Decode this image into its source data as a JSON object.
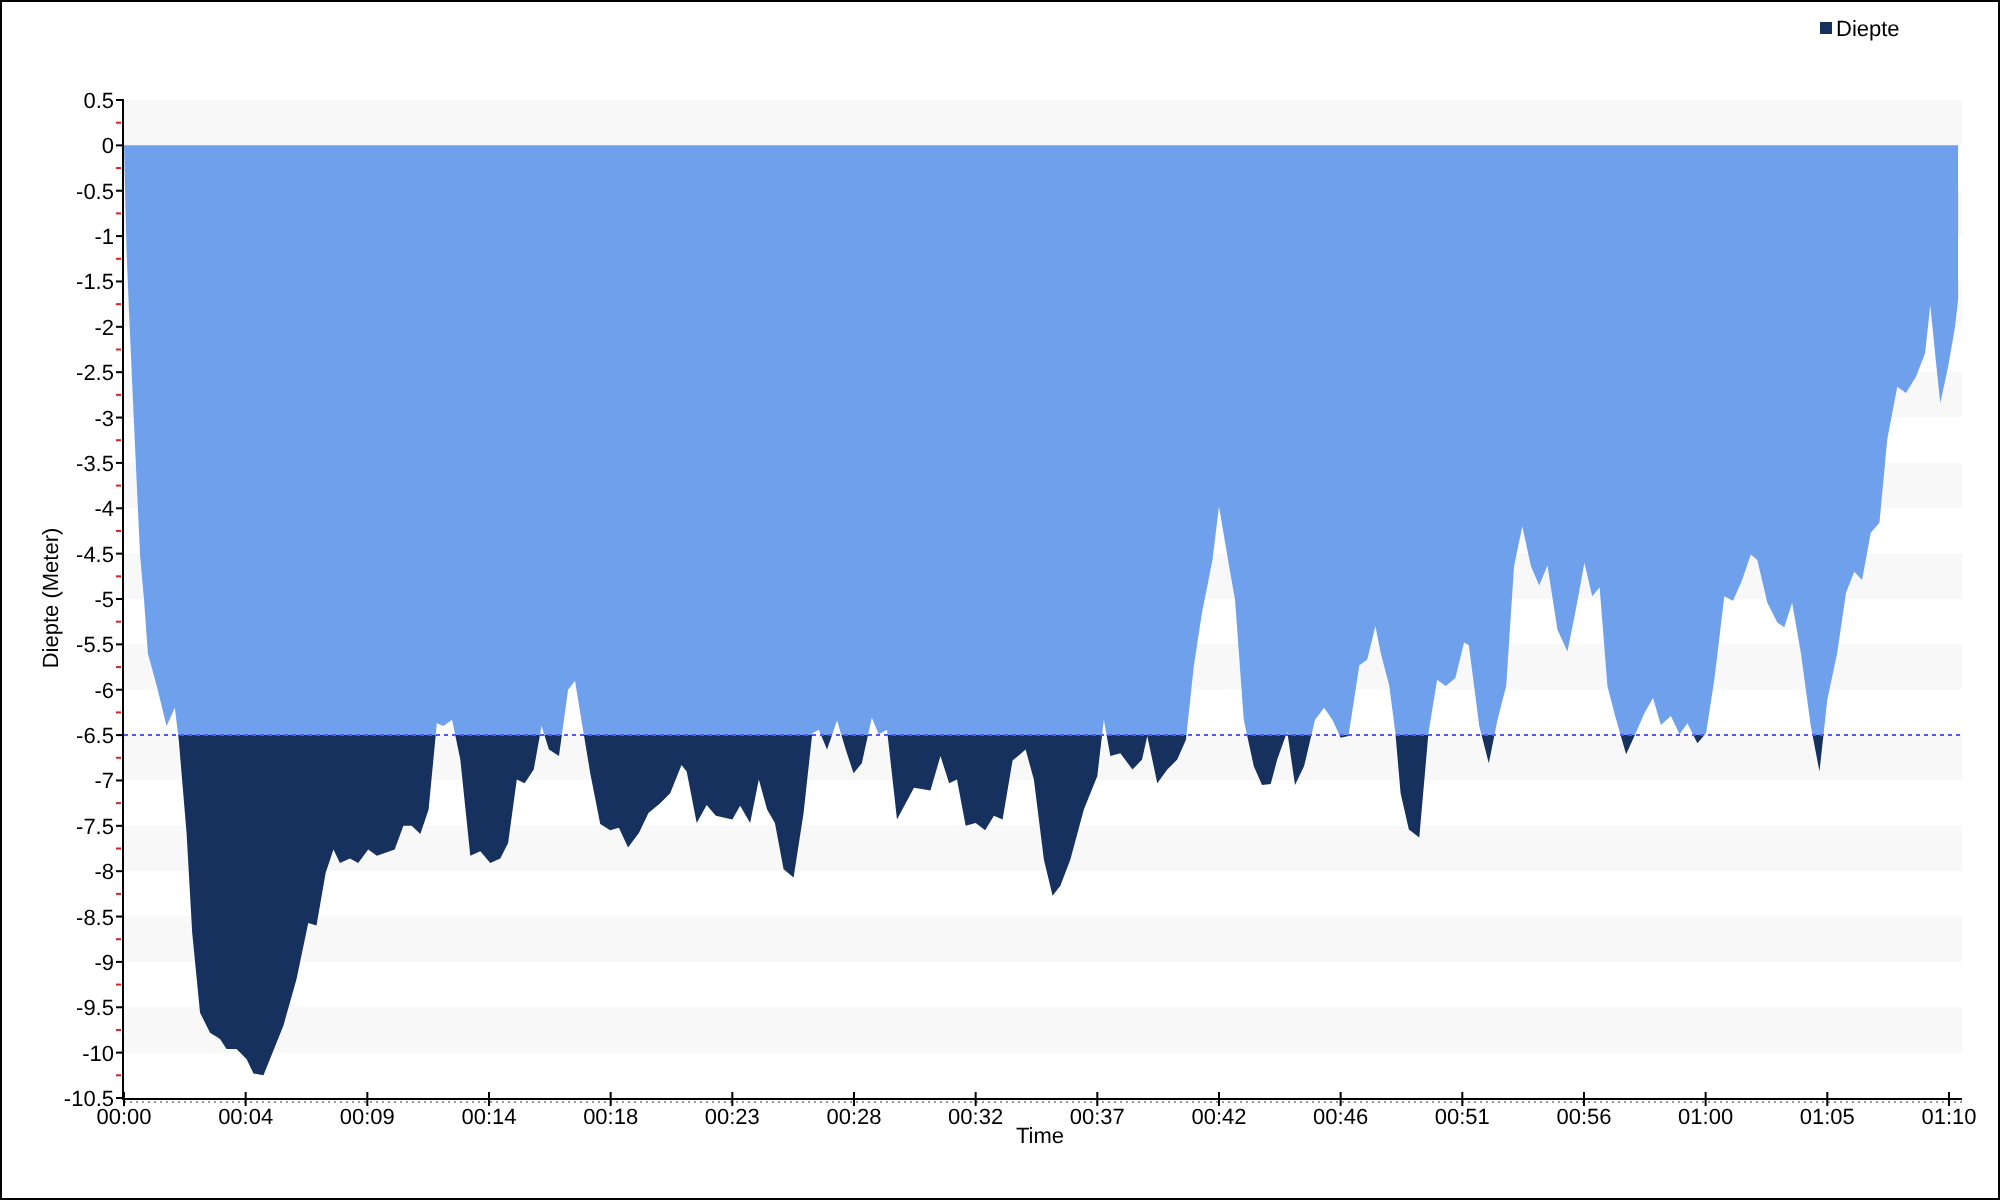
{
  "chart": {
    "chart_data": {
      "type": "area",
      "xlabel": "Time",
      "ylabel": "Diepte (Meter)",
      "x": [
        -20,
        -14,
        -9,
        -3,
        2,
        9,
        17,
        26,
        35,
        55,
        78,
        97,
        106,
        124,
        137,
        155,
        178,
        201,
        216,
        239,
        262,
        278,
        301,
        347,
        377,
        404,
        423,
        444,
        462,
        477,
        500,
        519,
        542,
        562,
        603,
        623,
        642,
        662,
        681,
        700,
        715,
        735,
        754,
        777,
        800,
        823,
        846,
        864,
        884,
        902,
        923,
        941,
        958,
        981,
        1002,
        1018,
        1035,
        1053,
        1076,
        1099,
        1119,
        1140,
        1165,
        1187,
        1214,
        1237,
        1263,
        1275,
        1298,
        1321,
        1342,
        1380,
        1398,
        1421,
        1441,
        1460,
        1478,
        1498,
        1521,
        1544,
        1564,
        1579,
        1598,
        1621,
        1641,
        1659,
        1678,
        1701,
        1717,
        1736,
        1759,
        1798,
        1836,
        1859,
        1879,
        1897,
        1917,
        1940,
        1962,
        1982,
        2002,
        2025,
        2055,
        2074,
        2097,
        2117,
        2135,
        2158,
        2189,
        2220,
        2235,
        2250,
        2273,
        2301,
        2323,
        2335,
        2358,
        2381,
        2404,
        2424,
        2442,
        2461,
        2485,
        2500,
        2522,
        2537,
        2557,
        2580,
        2599,
        2619,
        2634,
        2657,
        2675,
        2696,
        2721,
        2742,
        2761,
        2780,
        2798,
        2823,
        2841,
        2860,
        2872,
        2892,
        2906,
        2918,
        2937,
        2961,
        2982,
        3002,
        3022,
        3044,
        3064,
        3075,
        3099,
        3121,
        3141,
        3161,
        3179,
        3198,
        3218,
        3237,
        3256,
        3279,
        3302,
        3320,
        3341,
        3359,
        3376,
        3394,
        3410,
        3437,
        3459,
        3479,
        3499,
        3517,
        3540,
        3560,
        3578,
        3601,
        3621,
        3640,
        3663,
        3683,
        3704,
        3724,
        3739,
        3762,
        3785,
        3801,
        3819,
        3839,
        3862,
        3882,
        3900,
        3923,
        3943,
        3962,
        3980,
        4000,
        4020,
        4038,
        4061,
        4081,
        4104,
        4125,
        4137,
        4148,
        4160,
        4178,
        4194,
        4201
      ],
      "series": [
        {
          "name": "Diepte",
          "color": "#17315f",
          "values": [
            0,
            -1.19,
            -1.77,
            -2.43,
            -2.96,
            -3.69,
            -4.52,
            -5.0,
            -5.6,
            -5.95,
            -6.4,
            -6.2,
            -6.55,
            -7.58,
            -8.68,
            -9.56,
            -9.78,
            -9.85,
            -9.96,
            -9.96,
            -10.07,
            -10.23,
            -10.25,
            -9.7,
            -9.19,
            -8.57,
            -8.6,
            -8.02,
            -7.76,
            -7.91,
            -7.86,
            -7.91,
            -7.76,
            -7.83,
            -7.76,
            -7.5,
            -7.5,
            -7.59,
            -7.32,
            -6.37,
            -6.4,
            -6.33,
            -6.77,
            -7.83,
            -7.78,
            -7.91,
            -7.86,
            -7.69,
            -6.99,
            -7.03,
            -6.88,
            -6.4,
            -6.66,
            -6.73,
            -6.0,
            -5.9,
            -6.4,
            -6.92,
            -7.48,
            -7.55,
            -7.52,
            -7.74,
            -7.58,
            -7.36,
            -7.25,
            -7.14,
            -6.83,
            -6.9,
            -7.47,
            -7.27,
            -7.39,
            -7.43,
            -7.28,
            -7.47,
            -6.99,
            -7.32,
            -7.47,
            -7.98,
            -8.07,
            -7.36,
            -6.48,
            -6.44,
            -6.66,
            -6.34,
            -6.66,
            -6.92,
            -6.81,
            -6.31,
            -6.49,
            -6.44,
            -7.43,
            -7.08,
            -7.11,
            -6.73,
            -7.03,
            -6.99,
            -7.5,
            -7.47,
            -7.55,
            -7.39,
            -7.43,
            -6.78,
            -6.66,
            -6.99,
            -7.87,
            -8.27,
            -8.16,
            -7.87,
            -7.32,
            -6.95,
            -6.33,
            -6.73,
            -6.7,
            -6.88,
            -6.77,
            -6.51,
            -7.03,
            -6.88,
            -6.77,
            -6.55,
            -5.74,
            -5.15,
            -4.57,
            -3.98,
            -4.6,
            -5.01,
            -6.33,
            -6.84,
            -7.05,
            -7.04,
            -6.77,
            -6.46,
            -7.05,
            -6.84,
            -6.33,
            -6.2,
            -6.33,
            -6.53,
            -6.51,
            -5.73,
            -5.67,
            -5.3,
            -5.59,
            -5.96,
            -6.48,
            -7.14,
            -7.54,
            -7.63,
            -6.48,
            -5.89,
            -5.96,
            -5.87,
            -5.48,
            -5.51,
            -6.4,
            -6.81,
            -6.33,
            -5.96,
            -4.64,
            -4.2,
            -4.64,
            -4.85,
            -4.63,
            -5.34,
            -5.58,
            -5.15,
            -4.6,
            -4.97,
            -4.87,
            -5.96,
            -6.26,
            -6.71,
            -6.48,
            -6.26,
            -6.09,
            -6.39,
            -6.29,
            -6.49,
            -6.37,
            -6.59,
            -6.48,
            -5.89,
            -4.97,
            -5.02,
            -4.79,
            -4.51,
            -4.57,
            -5.04,
            -5.26,
            -5.31,
            -5.04,
            -5.59,
            -6.4,
            -6.9,
            -6.11,
            -5.59,
            -4.93,
            -4.7,
            -4.79,
            -4.27,
            -4.16,
            -3.24,
            -2.66,
            -2.73,
            -2.55,
            -2.29,
            -1.76,
            -2.29,
            -2.84,
            -2.44,
            -2.0,
            -1.7
          ]
        }
      ],
      "xlim": [
        -20,
        4210
      ],
      "ylim": [
        -10.5,
        0.5
      ],
      "xticks": [
        {
          "value": -20,
          "label": "00:00"
        },
        {
          "value": 260,
          "label": "00:04"
        },
        {
          "value": 540,
          "label": "00:09"
        },
        {
          "value": 820,
          "label": "00:14"
        },
        {
          "value": 1100,
          "label": "00:18"
        },
        {
          "value": 1380,
          "label": "00:23"
        },
        {
          "value": 1660,
          "label": "00:28"
        },
        {
          "value": 1940,
          "label": "00:32"
        },
        {
          "value": 2220,
          "label": "00:37"
        },
        {
          "value": 2500,
          "label": "00:42"
        },
        {
          "value": 2780,
          "label": "00:46"
        },
        {
          "value": 3060,
          "label": "00:51"
        },
        {
          "value": 3340,
          "label": "00:56"
        },
        {
          "value": 3620,
          "label": "01:00"
        },
        {
          "value": 3900,
          "label": "01:05"
        },
        {
          "value": 4180,
          "label": "01:10"
        }
      ],
      "yticks": [
        0.5,
        0,
        -0.5,
        -1,
        -1.5,
        -2,
        -2.5,
        -3,
        -3.5,
        -4,
        -4.5,
        -5,
        -5.5,
        -6,
        -6.5,
        -7,
        -7.5,
        -8,
        -8.5,
        -9,
        -9.5,
        -10,
        -10.5
      ],
      "ref_lines": [
        {
          "axis": "y",
          "value": -6.5
        }
      ]
    }
  }
}
